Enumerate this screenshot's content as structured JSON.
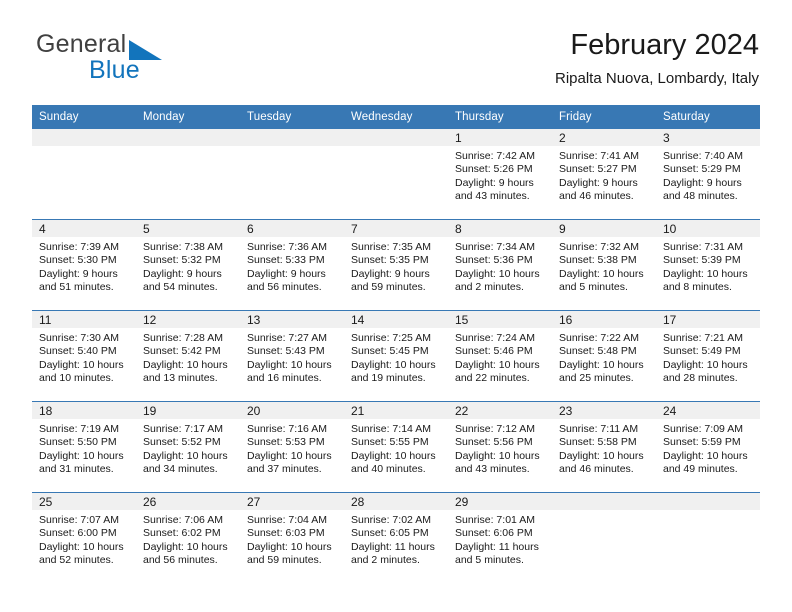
{
  "brand": {
    "name_top": "General",
    "name_bottom": "Blue",
    "accent_color": "#1274bc"
  },
  "header": {
    "title": "February 2024",
    "subtitle": "Ripalta Nuova, Lombardy, Italy"
  },
  "theme": {
    "header_row_bg": "#3878b4",
    "daynum_band_bg": "#f0f0f0",
    "text_color": "#1a1a1a",
    "page_bg": "#ffffff"
  },
  "weekday_headers": [
    "Sunday",
    "Monday",
    "Tuesday",
    "Wednesday",
    "Thursday",
    "Friday",
    "Saturday"
  ],
  "labels": {
    "sunrise_prefix": "Sunrise:",
    "sunset_prefix": "Sunset:",
    "daylight_prefix": "Daylight:"
  },
  "weeks": [
    [
      {
        "empty": true
      },
      {
        "empty": true
      },
      {
        "empty": true
      },
      {
        "empty": true
      },
      {
        "empty": false,
        "day": "1",
        "sunrise": "Sunrise: 7:42 AM",
        "sunset": "Sunset: 5:26 PM",
        "daylight_line1": "Daylight: 9 hours",
        "daylight_line2": "and 43 minutes."
      },
      {
        "empty": false,
        "day": "2",
        "sunrise": "Sunrise: 7:41 AM",
        "sunset": "Sunset: 5:27 PM",
        "daylight_line1": "Daylight: 9 hours",
        "daylight_line2": "and 46 minutes."
      },
      {
        "empty": false,
        "day": "3",
        "sunrise": "Sunrise: 7:40 AM",
        "sunset": "Sunset: 5:29 PM",
        "daylight_line1": "Daylight: 9 hours",
        "daylight_line2": "and 48 minutes."
      }
    ],
    [
      {
        "empty": false,
        "day": "4",
        "sunrise": "Sunrise: 7:39 AM",
        "sunset": "Sunset: 5:30 PM",
        "daylight_line1": "Daylight: 9 hours",
        "daylight_line2": "and 51 minutes."
      },
      {
        "empty": false,
        "day": "5",
        "sunrise": "Sunrise: 7:38 AM",
        "sunset": "Sunset: 5:32 PM",
        "daylight_line1": "Daylight: 9 hours",
        "daylight_line2": "and 54 minutes."
      },
      {
        "empty": false,
        "day": "6",
        "sunrise": "Sunrise: 7:36 AM",
        "sunset": "Sunset: 5:33 PM",
        "daylight_line1": "Daylight: 9 hours",
        "daylight_line2": "and 56 minutes."
      },
      {
        "empty": false,
        "day": "7",
        "sunrise": "Sunrise: 7:35 AM",
        "sunset": "Sunset: 5:35 PM",
        "daylight_line1": "Daylight: 9 hours",
        "daylight_line2": "and 59 minutes."
      },
      {
        "empty": false,
        "day": "8",
        "sunrise": "Sunrise: 7:34 AM",
        "sunset": "Sunset: 5:36 PM",
        "daylight_line1": "Daylight: 10 hours",
        "daylight_line2": "and 2 minutes."
      },
      {
        "empty": false,
        "day": "9",
        "sunrise": "Sunrise: 7:32 AM",
        "sunset": "Sunset: 5:38 PM",
        "daylight_line1": "Daylight: 10 hours",
        "daylight_line2": "and 5 minutes."
      },
      {
        "empty": false,
        "day": "10",
        "sunrise": "Sunrise: 7:31 AM",
        "sunset": "Sunset: 5:39 PM",
        "daylight_line1": "Daylight: 10 hours",
        "daylight_line2": "and 8 minutes."
      }
    ],
    [
      {
        "empty": false,
        "day": "11",
        "sunrise": "Sunrise: 7:30 AM",
        "sunset": "Sunset: 5:40 PM",
        "daylight_line1": "Daylight: 10 hours",
        "daylight_line2": "and 10 minutes."
      },
      {
        "empty": false,
        "day": "12",
        "sunrise": "Sunrise: 7:28 AM",
        "sunset": "Sunset: 5:42 PM",
        "daylight_line1": "Daylight: 10 hours",
        "daylight_line2": "and 13 minutes."
      },
      {
        "empty": false,
        "day": "13",
        "sunrise": "Sunrise: 7:27 AM",
        "sunset": "Sunset: 5:43 PM",
        "daylight_line1": "Daylight: 10 hours",
        "daylight_line2": "and 16 minutes."
      },
      {
        "empty": false,
        "day": "14",
        "sunrise": "Sunrise: 7:25 AM",
        "sunset": "Sunset: 5:45 PM",
        "daylight_line1": "Daylight: 10 hours",
        "daylight_line2": "and 19 minutes."
      },
      {
        "empty": false,
        "day": "15",
        "sunrise": "Sunrise: 7:24 AM",
        "sunset": "Sunset: 5:46 PM",
        "daylight_line1": "Daylight: 10 hours",
        "daylight_line2": "and 22 minutes."
      },
      {
        "empty": false,
        "day": "16",
        "sunrise": "Sunrise: 7:22 AM",
        "sunset": "Sunset: 5:48 PM",
        "daylight_line1": "Daylight: 10 hours",
        "daylight_line2": "and 25 minutes."
      },
      {
        "empty": false,
        "day": "17",
        "sunrise": "Sunrise: 7:21 AM",
        "sunset": "Sunset: 5:49 PM",
        "daylight_line1": "Daylight: 10 hours",
        "daylight_line2": "and 28 minutes."
      }
    ],
    [
      {
        "empty": false,
        "day": "18",
        "sunrise": "Sunrise: 7:19 AM",
        "sunset": "Sunset: 5:50 PM",
        "daylight_line1": "Daylight: 10 hours",
        "daylight_line2": "and 31 minutes."
      },
      {
        "empty": false,
        "day": "19",
        "sunrise": "Sunrise: 7:17 AM",
        "sunset": "Sunset: 5:52 PM",
        "daylight_line1": "Daylight: 10 hours",
        "daylight_line2": "and 34 minutes."
      },
      {
        "empty": false,
        "day": "20",
        "sunrise": "Sunrise: 7:16 AM",
        "sunset": "Sunset: 5:53 PM",
        "daylight_line1": "Daylight: 10 hours",
        "daylight_line2": "and 37 minutes."
      },
      {
        "empty": false,
        "day": "21",
        "sunrise": "Sunrise: 7:14 AM",
        "sunset": "Sunset: 5:55 PM",
        "daylight_line1": "Daylight: 10 hours",
        "daylight_line2": "and 40 minutes."
      },
      {
        "empty": false,
        "day": "22",
        "sunrise": "Sunrise: 7:12 AM",
        "sunset": "Sunset: 5:56 PM",
        "daylight_line1": "Daylight: 10 hours",
        "daylight_line2": "and 43 minutes."
      },
      {
        "empty": false,
        "day": "23",
        "sunrise": "Sunrise: 7:11 AM",
        "sunset": "Sunset: 5:58 PM",
        "daylight_line1": "Daylight: 10 hours",
        "daylight_line2": "and 46 minutes."
      },
      {
        "empty": false,
        "day": "24",
        "sunrise": "Sunrise: 7:09 AM",
        "sunset": "Sunset: 5:59 PM",
        "daylight_line1": "Daylight: 10 hours",
        "daylight_line2": "and 49 minutes."
      }
    ],
    [
      {
        "empty": false,
        "day": "25",
        "sunrise": "Sunrise: 7:07 AM",
        "sunset": "Sunset: 6:00 PM",
        "daylight_line1": "Daylight: 10 hours",
        "daylight_line2": "and 52 minutes."
      },
      {
        "empty": false,
        "day": "26",
        "sunrise": "Sunrise: 7:06 AM",
        "sunset": "Sunset: 6:02 PM",
        "daylight_line1": "Daylight: 10 hours",
        "daylight_line2": "and 56 minutes."
      },
      {
        "empty": false,
        "day": "27",
        "sunrise": "Sunrise: 7:04 AM",
        "sunset": "Sunset: 6:03 PM",
        "daylight_line1": "Daylight: 10 hours",
        "daylight_line2": "and 59 minutes."
      },
      {
        "empty": false,
        "day": "28",
        "sunrise": "Sunrise: 7:02 AM",
        "sunset": "Sunset: 6:05 PM",
        "daylight_line1": "Daylight: 11 hours",
        "daylight_line2": "and 2 minutes."
      },
      {
        "empty": false,
        "day": "29",
        "sunrise": "Sunrise: 7:01 AM",
        "sunset": "Sunset: 6:06 PM",
        "daylight_line1": "Daylight: 11 hours",
        "daylight_line2": "and 5 minutes."
      },
      {
        "empty": true
      },
      {
        "empty": true
      }
    ]
  ]
}
